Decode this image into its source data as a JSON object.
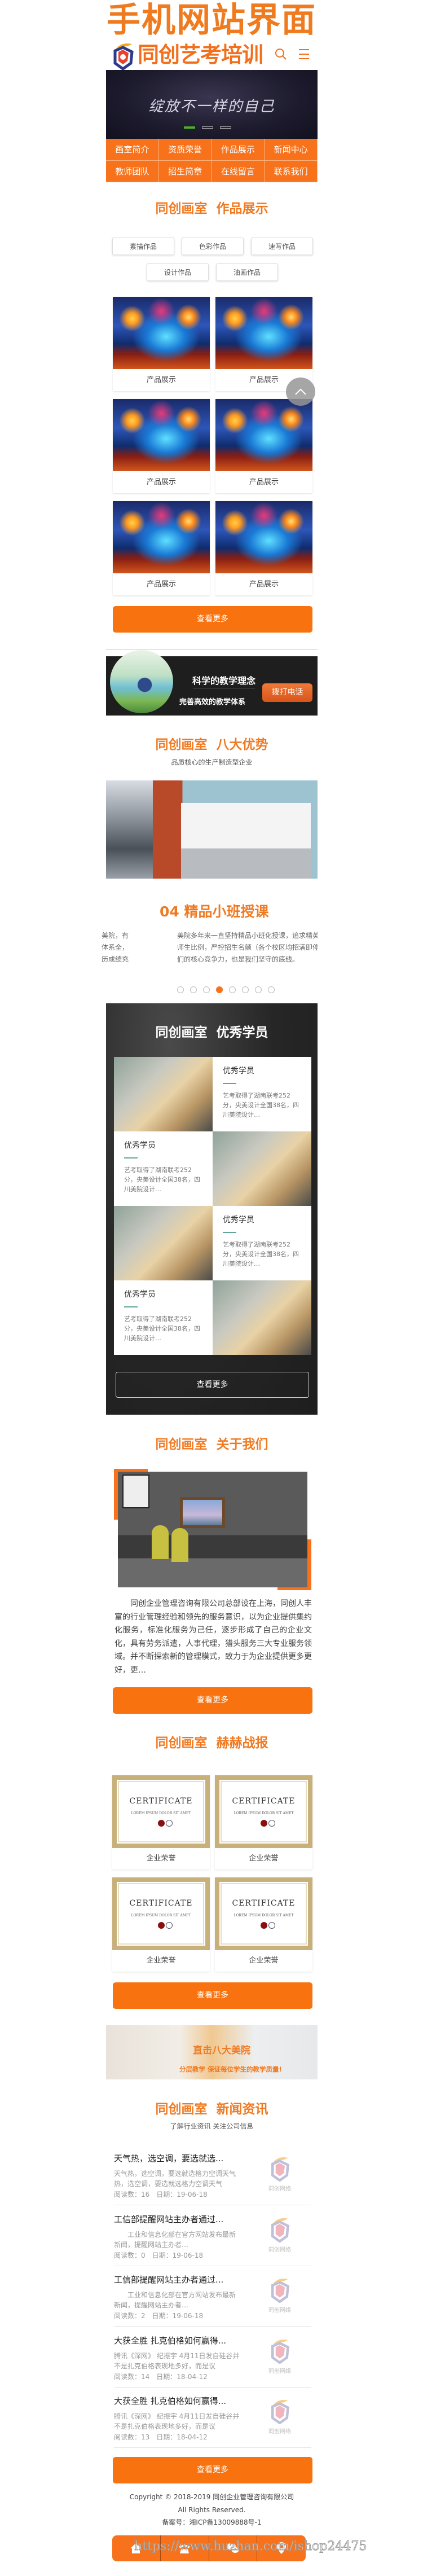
{
  "poster_title": "手机网站界面",
  "header": {
    "brand": "同创艺考培训",
    "search_icon": "search-icon",
    "menu_icon": "menu-icon"
  },
  "hero": {
    "slogan": "绽放不一样的自己",
    "slide_count": 3,
    "active_slide": 1
  },
  "nav": [
    "画室简介",
    "资质荣誉",
    "作品展示",
    "新闻中心",
    "教师团队",
    "招生简章",
    "在线留言",
    "联系我们"
  ],
  "works": {
    "title": "同创画室  作品展示",
    "filters": [
      "素描作品",
      "色彩作品",
      "速写作品",
      "设计作品",
      "油画作品"
    ],
    "items": [
      {
        "label": "产品展示"
      },
      {
        "label": "产品展示"
      },
      {
        "label": "产品展示"
      },
      {
        "label": "产品展示"
      },
      {
        "label": "产品展示"
      },
      {
        "label": "产品展示"
      }
    ],
    "more": "查看更多"
  },
  "back_to_top_icon": "chevron-up-icon",
  "promo": {
    "line1": "科学的教学理念",
    "line2": "完善高效的教学体系",
    "call": "拨打电话"
  },
  "advantages": {
    "title": "同创画室  八大优势",
    "subtitle": "品质核心的生产制造型企业",
    "prev_text": [
      "美院，有",
      "体系全，",
      "历成绩充"
    ],
    "slide_title": "04 精品小班授课",
    "slide_text": [
      "美院多年来一直坚持精品小班化授课，追求精英",
      "师生比例，严控招生名额（各个校区均招满即停",
      "们的核心竞争力，也是我们坚守的底线。"
    ],
    "dots": 8,
    "active_dot": 4
  },
  "students": {
    "title": "同创画室  优秀学员",
    "items": [
      {
        "name": "优秀学员",
        "desc": "艺考取得了湖南联考252分，央美设计全国38名，四川美院设计…"
      },
      {
        "name": "优秀学员",
        "desc": "艺考取得了湖南联考252分，央美设计全国38名，四川美院设计…"
      },
      {
        "name": "优秀学员",
        "desc": "艺考取得了湖南联考252分，央美设计全国38名，四川美院设计…"
      },
      {
        "name": "优秀学员",
        "desc": "艺考取得了湖南联考252分，央美设计全国38名，四川美院设计…"
      }
    ],
    "more": "查看更多"
  },
  "about": {
    "title": "同创画室  关于我们",
    "text": "同创企业管理咨询有限公司总部设在上海，同创人丰富的行业管理经验和领先的服务意识，以为企业提供集约化服务，标准化服务为己任，逐步形成了自己的企业文化，具有劳务派遣，人事代理，猎头服务三大专业服务领域。并不断探索新的管理模式，致力于为企业提供更多更好，更…",
    "more": "查看更多"
  },
  "honors": {
    "title": "同创画室  赫赫战报",
    "items": [
      {
        "label": "企业荣誉",
        "cert": "CERTIFICATE",
        "cert_sub": "LOREM IPSUM DOLOR SIT AMET"
      },
      {
        "label": "企业荣誉",
        "cert": "CERTIFICATE",
        "cert_sub": "LOREM IPSUM DOLOR SIT AMET"
      },
      {
        "label": "企业荣誉",
        "cert": "CERTIFICATE",
        "cert_sub": "LOREM IPSUM DOLOR SIT AMET"
      },
      {
        "label": "企业荣誉",
        "cert": "CERTIFICATE",
        "cert_sub": "LOREM IPSUM DOLOR SIT AMET"
      }
    ],
    "more": "查看更多"
  },
  "banner2": {
    "line1": "直击八大美院",
    "line2": "分层教学 保证每位学生的教学质量!"
  },
  "news": {
    "title": "同创画室  新闻资讯",
    "subtitle": "了解行业资讯 关注公司信息",
    "items": [
      {
        "title": "天气热，选空调，要选就选...",
        "desc": "天气热，选空调，要选就选格力空调天气热，选空调，要选就选格力空调天气",
        "meta": "阅读数：16　日期：19-06-18"
      },
      {
        "title": "工信部提醒网站主办者通过...",
        "desc": "　　工业和信息化部在官方网站发布最新新闻，提醒网站主办者…",
        "meta": "阅读数：0　日期：19-06-18"
      },
      {
        "title": "工信部提醒网站主办者通过...",
        "desc": "　　工业和信息化部在官方网站发布最新新闻，提醒网站主办者…",
        "meta": "阅读数：2　日期：19-06-18"
      },
      {
        "title": "大获全胜 扎克伯格如何赢得...",
        "desc": "腾讯《深网》 纪振宇 4月11日发自硅谷并不是扎克伯格表现地多好，而是议",
        "meta": "阅读数：14　日期：18-04-12"
      },
      {
        "title": "大获全胜 扎克伯格如何赢得...",
        "desc": "腾讯《深网》 纪振宇 4月11日发自硅谷并不是扎克伯格表现地多好，而是议",
        "meta": "阅读数：13　日期：18-04-12"
      }
    ],
    "thumb_text": "同创网络",
    "more": "查看更多"
  },
  "footer": {
    "copyright": "Copyright © 2018-2019 同创企业管理咨询有限公司",
    "rights": "All Rights Reserved.",
    "icp": "备案号：湘ICP备13009888号-1",
    "bar_icons": [
      "home-icon",
      "phone-icon",
      "chat-icon",
      "location-icon"
    ]
  },
  "watermark": "https://www.huzhan.com/ishop24475",
  "colors": {
    "accent": "#f7721a",
    "title": "#f07a22",
    "dark": "#262626",
    "teal": "#5fa59a"
  }
}
